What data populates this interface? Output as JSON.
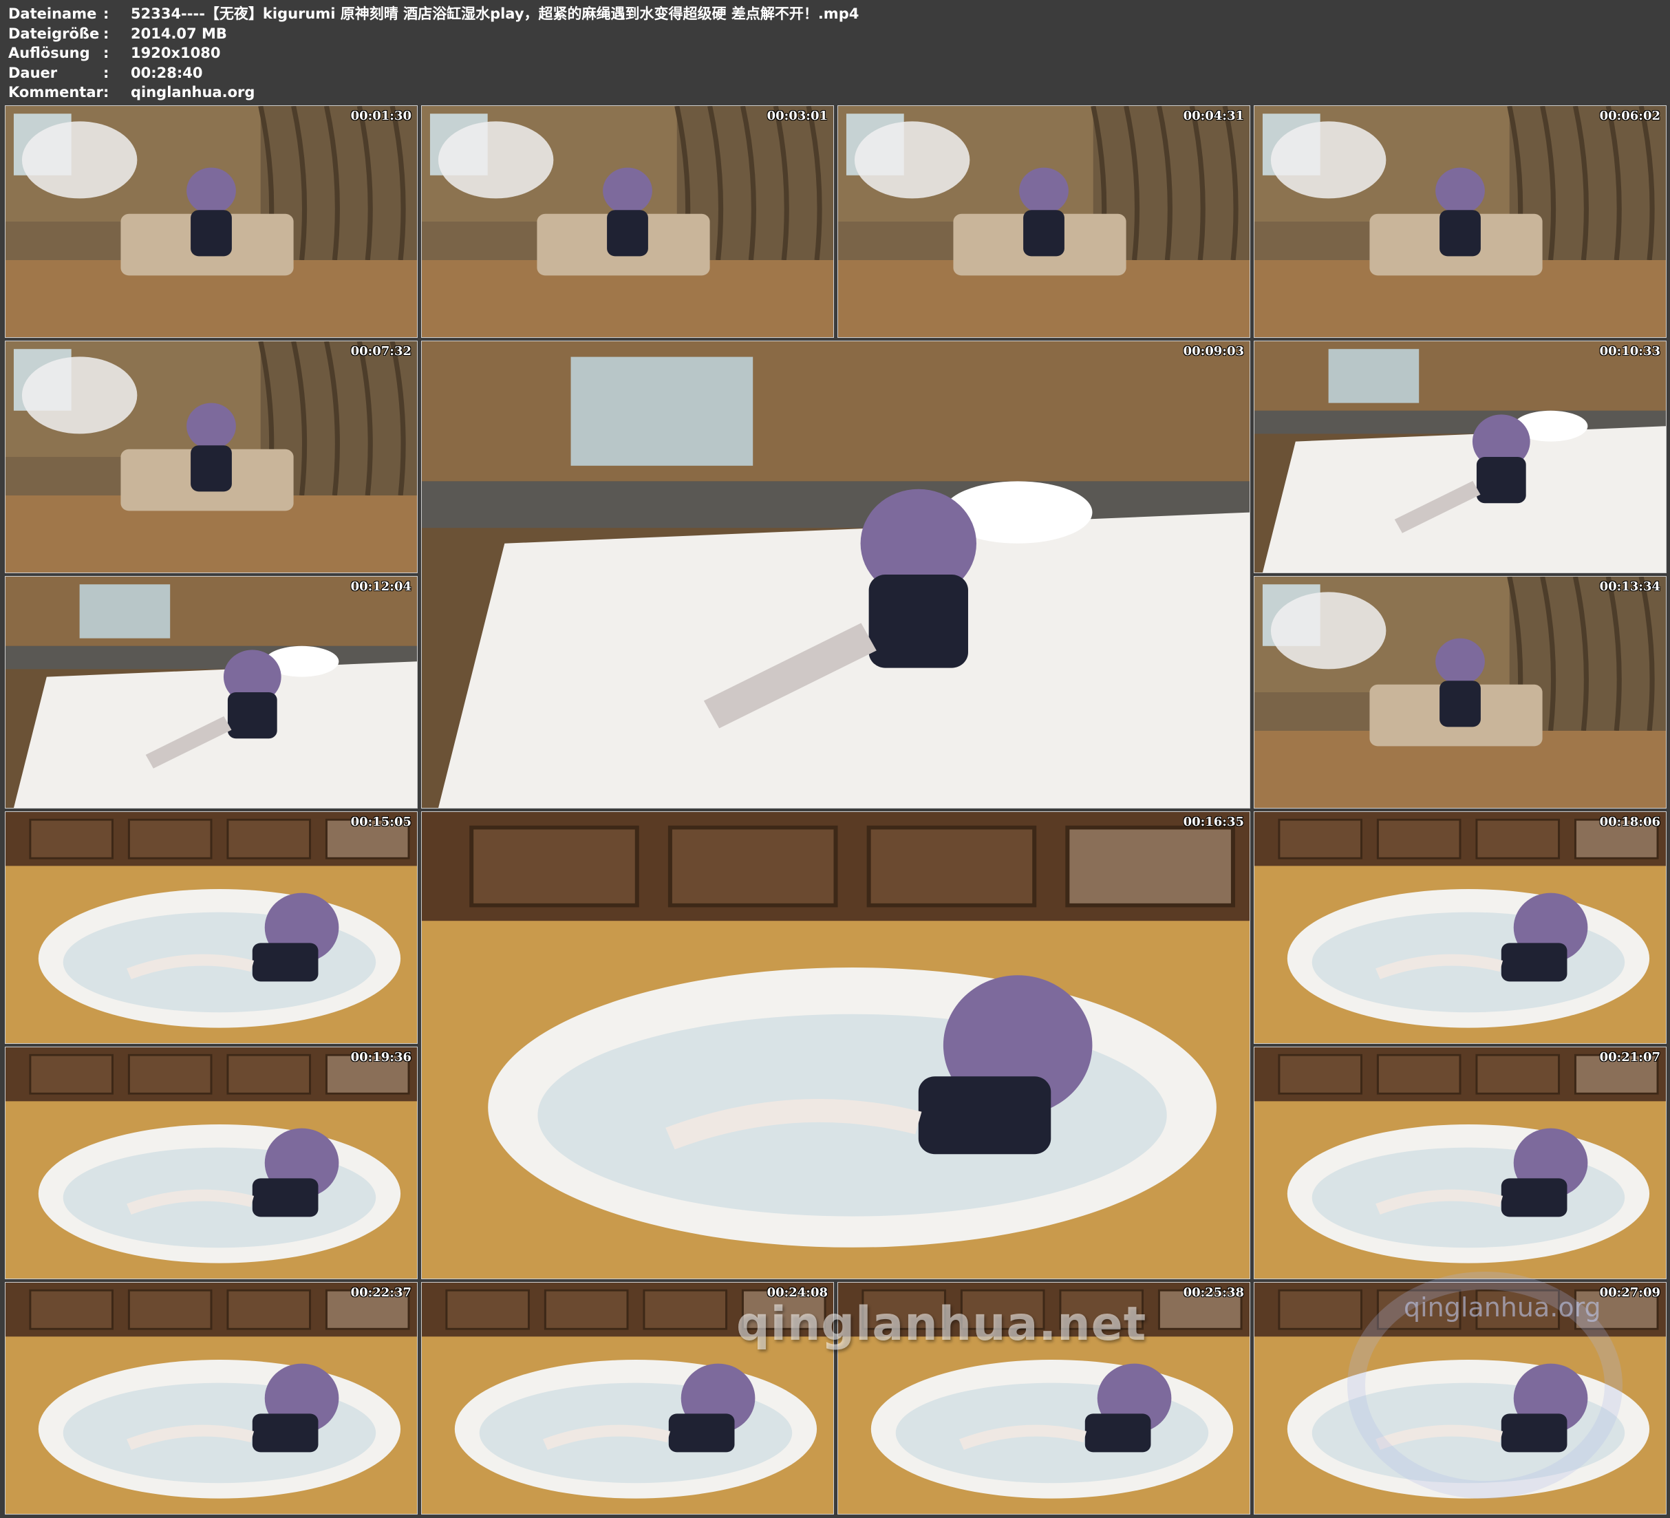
{
  "meta": {
    "rows": [
      {
        "label": "Dateiname",
        "sep": ":",
        "value": "52334----【无夜】kigurumi 原神刻晴 酒店浴缸湿水play，超紧的麻绳遇到水变得超级硬 差点解不开！.mp4"
      },
      {
        "label": "Dateigröße",
        "sep": ":",
        "value": "2014.07 MB"
      },
      {
        "label": "Auflösung",
        "sep": ":",
        "value": "1920x1080"
      },
      {
        "label": "Dauer",
        "sep": ":",
        "value": "00:28:40"
      },
      {
        "label": "Kommentar",
        "sep": ":",
        "value": "qinglanhua.org"
      }
    ]
  },
  "frames": [
    {
      "time": "00:01:30",
      "scene": "room"
    },
    {
      "time": "00:03:01",
      "scene": "room"
    },
    {
      "time": "00:04:31",
      "scene": "room"
    },
    {
      "time": "00:06:02",
      "scene": "room"
    },
    {
      "time": "00:07:32",
      "scene": "room"
    },
    {
      "time": "00:09:03",
      "scene": "bed"
    },
    {
      "time": "00:10:33",
      "scene": "bed"
    },
    {
      "time": "00:12:04",
      "scene": "bed"
    },
    {
      "time": "00:13:34",
      "scene": "room"
    },
    {
      "time": "00:15:05",
      "scene": "bath"
    },
    {
      "time": "00:16:35",
      "scene": "bath"
    },
    {
      "time": "00:18:06",
      "scene": "bath"
    },
    {
      "time": "00:19:36",
      "scene": "bath"
    },
    {
      "time": "00:21:07",
      "scene": "bath"
    },
    {
      "time": "00:22:37",
      "scene": "bath"
    },
    {
      "time": "00:24:08",
      "scene": "bath"
    },
    {
      "time": "00:25:38",
      "scene": "bath"
    },
    {
      "time": "00:27:09",
      "scene": "bath"
    }
  ],
  "watermarks": {
    "net": "qinglanhua.net",
    "org": "qinglanhua.org"
  },
  "colors": {
    "background": "#3c3c3c",
    "text": "#ffffff"
  }
}
